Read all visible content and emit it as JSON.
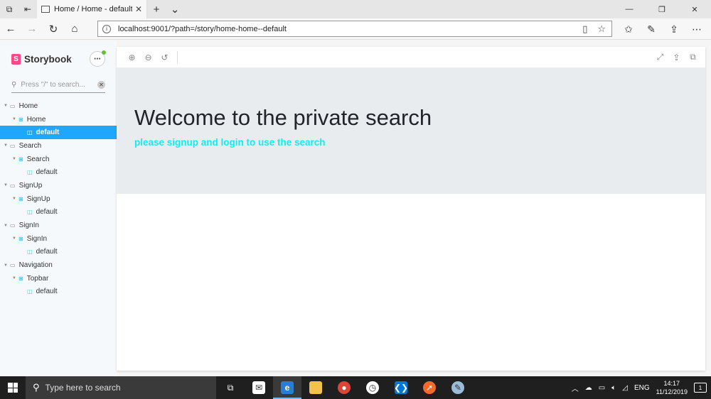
{
  "browser": {
    "tab_title": "Home / Home - default",
    "tab_close": "✕",
    "new_tab": "+",
    "tab_dropdown": "⌄",
    "window_controls": [
      "—",
      "❐",
      "✕"
    ],
    "url": "localhost:9001/?path=/story/home-home--default",
    "url_info": "i",
    "toolbar_icons": [
      "favorites-icon",
      "pen-icon",
      "share-icon",
      "more-icon"
    ],
    "more_label": "⋯"
  },
  "storybook": {
    "title": "Storybook",
    "logo_letter": "S",
    "menu_label": "⋯",
    "search_placeholder": "Press \"/\" to search...",
    "search_clear": "✕",
    "brand_color": "#ff4785",
    "selected_color": "#1ea7fd",
    "tree": [
      {
        "label": "Home",
        "level": 0,
        "type": "folder",
        "icon": "folder-icon"
      },
      {
        "label": "Home",
        "level": 1,
        "type": "component",
        "icon": "component-icon"
      },
      {
        "label": "default",
        "level": 2,
        "type": "story",
        "icon": "story-icon",
        "selected": true
      },
      {
        "label": "Search",
        "level": 0,
        "type": "folder",
        "icon": "folder-icon"
      },
      {
        "label": "Search",
        "level": 1,
        "type": "component",
        "icon": "component-icon"
      },
      {
        "label": "default",
        "level": 2,
        "type": "story",
        "icon": "story-icon"
      },
      {
        "label": "SignUp",
        "level": 0,
        "type": "folder",
        "icon": "folder-icon"
      },
      {
        "label": "SignUp",
        "level": 1,
        "type": "component",
        "icon": "component-icon"
      },
      {
        "label": "default",
        "level": 2,
        "type": "story",
        "icon": "story-icon"
      },
      {
        "label": "SignIn",
        "level": 0,
        "type": "folder",
        "icon": "folder-icon"
      },
      {
        "label": "SignIn",
        "level": 1,
        "type": "component",
        "icon": "component-icon"
      },
      {
        "label": "default",
        "level": 2,
        "type": "story",
        "icon": "story-icon"
      },
      {
        "label": "Navigation",
        "level": 0,
        "type": "folder",
        "icon": "folder-icon"
      },
      {
        "label": "Topbar",
        "level": 1,
        "type": "component",
        "icon": "component-icon"
      },
      {
        "label": "default",
        "level": 2,
        "type": "story",
        "icon": "story-icon"
      }
    ]
  },
  "preview": {
    "toolbar_left": [
      "zoom-in-icon",
      "zoom-out-icon",
      "zoom-reset-icon"
    ],
    "toolbar_right": [
      "fullscreen-icon",
      "share-icon",
      "open-new-tab-icon"
    ],
    "hero_title": "Welcome to the private search",
    "hero_subtitle": "please signup and login to use the search",
    "subtitle_color": "#17e9f0"
  },
  "taskbar": {
    "search_placeholder": "Type here to search",
    "apps": [
      "task-view-icon",
      "mail-icon",
      "edge-icon",
      "file-explorer-icon",
      "chrome-icon",
      "alarm-icon",
      "vscode-icon",
      "brave-icon",
      "paint-icon"
    ],
    "language": "ENG",
    "time": "14:17",
    "date": "11/12/2019",
    "notifications": "1"
  }
}
